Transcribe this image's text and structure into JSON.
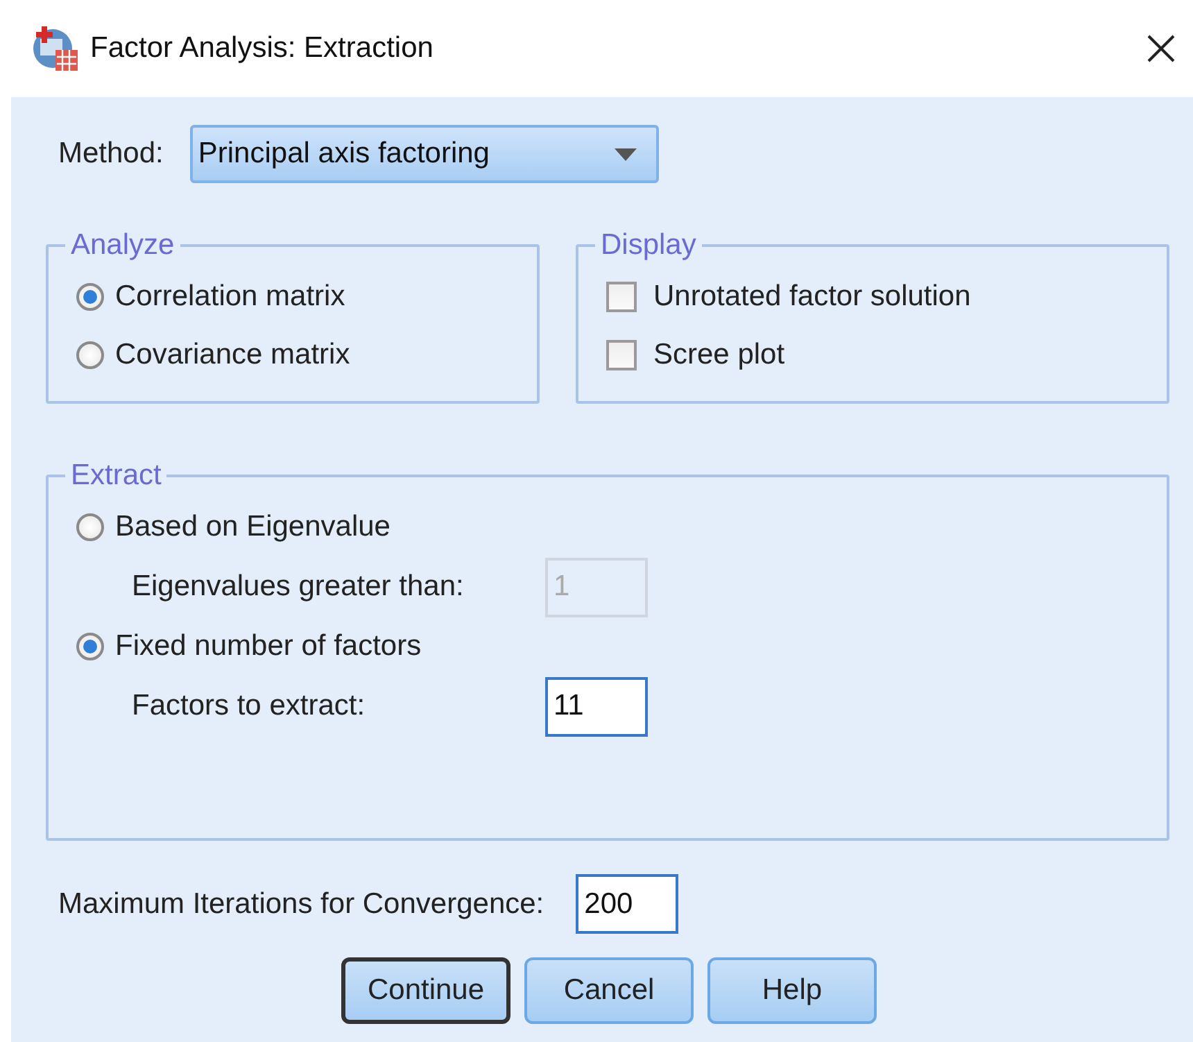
{
  "window": {
    "title": "Factor Analysis: Extraction"
  },
  "method": {
    "label": "Method:",
    "value": "Principal axis factoring"
  },
  "analyze": {
    "title": "Analyze",
    "options": [
      {
        "label": "Correlation matrix",
        "selected": true
      },
      {
        "label": "Covariance matrix",
        "selected": false
      }
    ]
  },
  "display": {
    "title": "Display",
    "options": [
      {
        "label": "Unrotated factor solution",
        "checked": false
      },
      {
        "label": "Scree plot",
        "checked": false
      }
    ]
  },
  "extract": {
    "title": "Extract",
    "options": [
      {
        "label": "Based on Eigenvalue",
        "selected": false,
        "field": {
          "label": "Eigenvalues greater than:",
          "value": "1",
          "disabled": true
        }
      },
      {
        "label": "Fixed number of factors",
        "selected": true,
        "field": {
          "label": "Factors to extract:",
          "value": "11",
          "disabled": false
        }
      }
    ]
  },
  "max_iterations": {
    "label": "Maximum Iterations for Convergence:",
    "value": "200"
  },
  "buttons": [
    {
      "label": "Continue",
      "default": true
    },
    {
      "label": "Cancel",
      "default": false
    },
    {
      "label": "Help",
      "default": false
    }
  ]
}
